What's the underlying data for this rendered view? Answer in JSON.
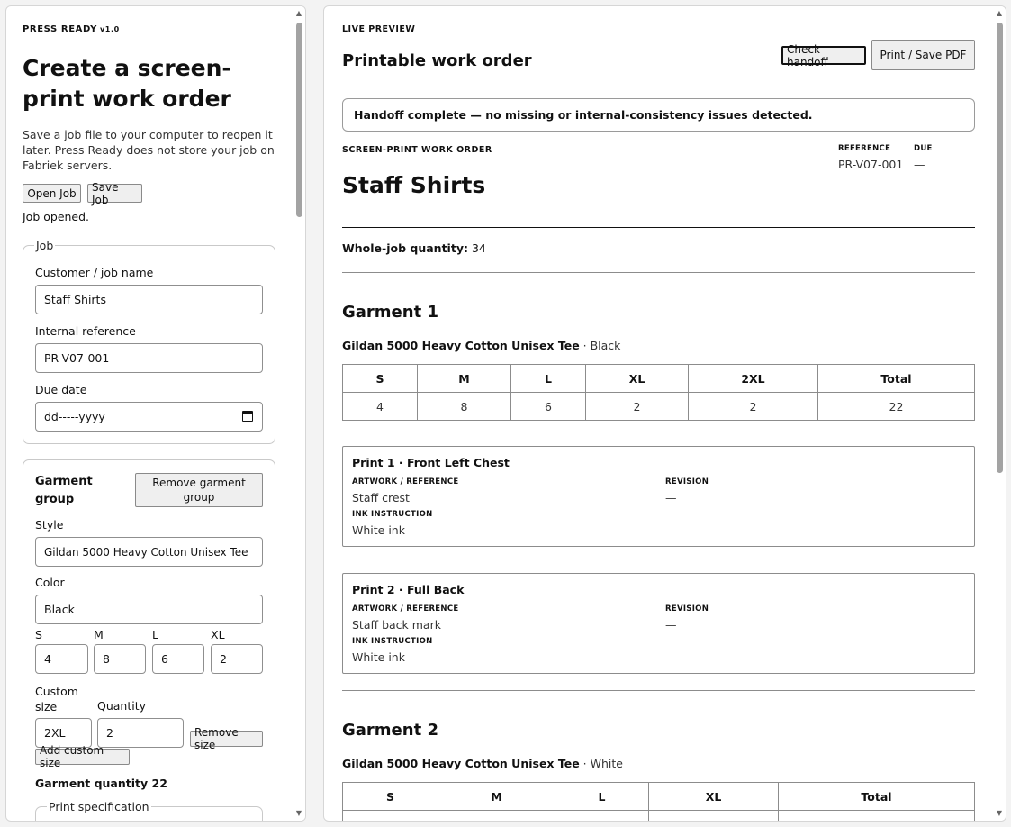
{
  "app": {
    "name": "PRESS READY",
    "version": "v1.0"
  },
  "left": {
    "title": "Create a screen-print work order",
    "description": "Save a job file to your computer to reopen it later. Press Ready does not store your job on Fabriek servers.",
    "open_job_label": "Open Job",
    "save_job_label": "Save Job",
    "status": "Job opened.",
    "job_section": {
      "legend": "Job",
      "customer_label": "Customer / job name",
      "customer_value": "Staff Shirts",
      "reference_label": "Internal reference",
      "reference_value": "PR-V07-001",
      "due_label": "Due date",
      "due_placeholder": "dd-----yyyy"
    },
    "garment_group": {
      "title": "Garment group",
      "remove_label": "Remove garment group",
      "style_label": "Style",
      "style_value": "Gildan 5000 Heavy Cotton Unisex Tee",
      "color_label": "Color",
      "color_value": "Black",
      "sizes": [
        {
          "label": "S",
          "value": "4"
        },
        {
          "label": "M",
          "value": "8"
        },
        {
          "label": "L",
          "value": "6"
        },
        {
          "label": "XL",
          "value": "2"
        }
      ],
      "custom_size_label": "Custom size",
      "custom_quantity_label": "Quantity",
      "custom_size_value": "2XL",
      "custom_quantity_value": "2",
      "remove_size_label": "Remove size",
      "add_custom_size_label": "Add custom size",
      "garment_quantity_text": "Garment quantity 22",
      "print_spec_legend": "Print specification"
    }
  },
  "right": {
    "kicker": "LIVE PREVIEW",
    "heading": "Printable work order",
    "check_handoff_label": "Check handoff",
    "print_pdf_label": "Print / Save PDF",
    "notice": "Handoff complete — no missing or internal-consistency issues detected.",
    "work_order": {
      "kicker": "SCREEN-PRINT WORK ORDER",
      "reference_label": "REFERENCE",
      "reference_value": "PR-V07-001",
      "due_label": "DUE",
      "due_value": "—",
      "title": "Staff Shirts",
      "quantity_label": "Whole-job quantity:",
      "quantity_value": "34",
      "garments": [
        {
          "heading": "Garment 1",
          "style": "Gildan 5000 Heavy Cotton Unisex Tee",
          "color": "· Black",
          "headers": [
            "S",
            "M",
            "L",
            "XL",
            "2XL",
            "Total"
          ],
          "values": [
            "4",
            "8",
            "6",
            "2",
            "2",
            "22"
          ],
          "prints": [
            {
              "title": "Print 1 · Front Left Chest",
              "artwork_label": "ARTWORK / REFERENCE",
              "artwork_value": "Staff crest",
              "revision_label": "REVISION",
              "revision_value": "—",
              "ink_label": "INK INSTRUCTION",
              "ink_value": "White ink"
            },
            {
              "title": "Print 2 · Full Back",
              "artwork_label": "ARTWORK / REFERENCE",
              "artwork_value": "Staff back mark",
              "revision_label": "REVISION",
              "revision_value": "—",
              "ink_label": "INK INSTRUCTION",
              "ink_value": "White ink"
            }
          ]
        },
        {
          "heading": "Garment 2",
          "style": "Gildan 5000 Heavy Cotton Unisex Tee",
          "color": "· White",
          "headers": [
            "S",
            "M",
            "L",
            "XL",
            "Total"
          ]
        }
      ]
    }
  }
}
